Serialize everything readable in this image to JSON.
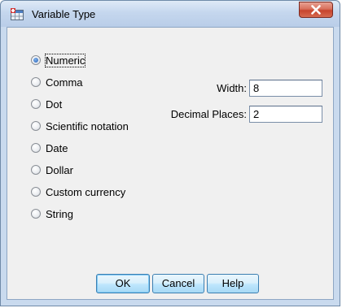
{
  "window": {
    "title": "Variable Type"
  },
  "type_options": [
    {
      "label": "Numeric",
      "checked": true
    },
    {
      "label": "Comma",
      "checked": false
    },
    {
      "label": "Dot",
      "checked": false
    },
    {
      "label": "Scientific notation",
      "checked": false
    },
    {
      "label": "Date",
      "checked": false
    },
    {
      "label": "Dollar",
      "checked": false
    },
    {
      "label": "Custom currency",
      "checked": false
    },
    {
      "label": "String",
      "checked": false
    }
  ],
  "fields": {
    "width_label": "Width:",
    "width_value": "8",
    "decimal_label": "Decimal Places:",
    "decimal_value": "2"
  },
  "buttons": {
    "ok": "OK",
    "cancel": "Cancel",
    "help": "Help"
  },
  "colors": {
    "title_bar": "#c5d7ee",
    "close_button": "#c7432c",
    "dialog_background": "#f0f0f0",
    "button_face": "#bee6fd",
    "selected_radio": "#2a63b8"
  },
  "icons": {
    "app": "variable-type-icon",
    "close": "close-icon"
  }
}
